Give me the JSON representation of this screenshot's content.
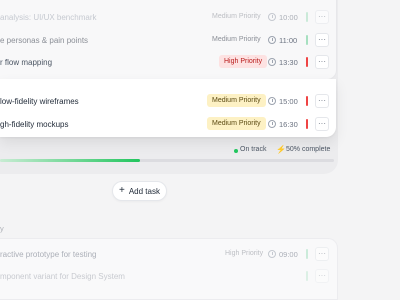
{
  "tasks_top": [
    {
      "title": "analysis: UI/UX benchmark",
      "priority": "Medium Priority",
      "time": "10:00",
      "bar_color": "#a7e0c0"
    },
    {
      "title": "e personas & pain points",
      "priority": "Medium Priority",
      "time": "11:00",
      "bar_color": "#a7e0c0"
    },
    {
      "title": "r flow mapping",
      "priority": "High Priority",
      "time": "13:30",
      "bar_color": "#ef4444"
    }
  ],
  "tasks_main": [
    {
      "title": "low-fidelity wireframes",
      "priority": "Medium Priority",
      "time": "15:00",
      "bar_color": "#ef4444"
    },
    {
      "title": "gh-fidelity mockups",
      "priority": "Medium Priority",
      "time": "16:30",
      "bar_color": "#ef4444"
    }
  ],
  "status": {
    "on_track": "On track",
    "complete": "50% complete",
    "progress": 0.42,
    "accent": "#22c55e"
  },
  "add_task_label": "Add task",
  "plus_glyph": "+",
  "more_glyph": "···",
  "bolt_glyph": "⚡",
  "section_label": "y",
  "tasks_lower": [
    {
      "title": "ractive prototype for testing",
      "priority": "High Priority",
      "time": "09:00",
      "bar_color": "#a7e0c0"
    },
    {
      "title": "mponent variant for Design System",
      "priority": "",
      "time": "",
      "bar_color": ""
    }
  ]
}
